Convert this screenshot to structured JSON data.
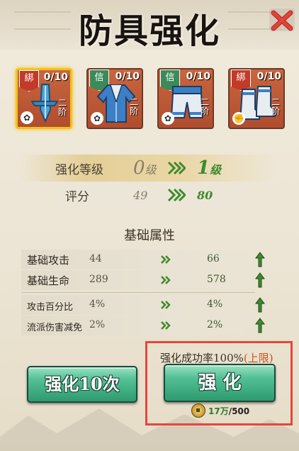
{
  "title": "防具强化",
  "slots": [
    {
      "tag": "綁",
      "tag_color": "red",
      "count": "0/10",
      "tier": "二阶",
      "badge": "✿",
      "item": "amulet",
      "selected": true
    },
    {
      "tag": "信",
      "tag_color": "green",
      "count": "0/10",
      "tier": "二阶",
      "badge": "✿",
      "item": "robe",
      "selected": false
    },
    {
      "tag": "信",
      "tag_color": "green",
      "count": "0/10",
      "tier": "二阶",
      "badge": "✿",
      "item": "pants",
      "selected": false
    },
    {
      "tag": "綁",
      "tag_color": "red",
      "count": "0/10",
      "tier": "二阶",
      "badge": "✊",
      "item": "boots",
      "selected": false
    }
  ],
  "level": {
    "label": "强化等级",
    "from_num": "0",
    "from_unit": "级",
    "to_num": "1",
    "to_unit": "级"
  },
  "score": {
    "label": "评分",
    "from": "49",
    "to": "80"
  },
  "section_title": "基础属性",
  "attributes": [
    {
      "name": "基础攻击",
      "from": "44",
      "to": "66"
    },
    {
      "name": "基础生命",
      "from": "289",
      "to": "578"
    },
    {
      "name": "攻击百分比",
      "from": "4%",
      "to": "4%"
    },
    {
      "name": "流派伤害减免",
      "from": "2%",
      "to": "2%"
    }
  ],
  "buttons": {
    "enhance10": "强化10次",
    "enhance": "强 化"
  },
  "success_rate": {
    "text": "强化成功率100%",
    "limit": "(上限)"
  },
  "cost": {
    "amount": "17万",
    "total": "/500"
  },
  "colors": {
    "accent_green": "#3f8a2c",
    "highlight_box": "#e2473d",
    "button_green": "#2f9a6f"
  }
}
